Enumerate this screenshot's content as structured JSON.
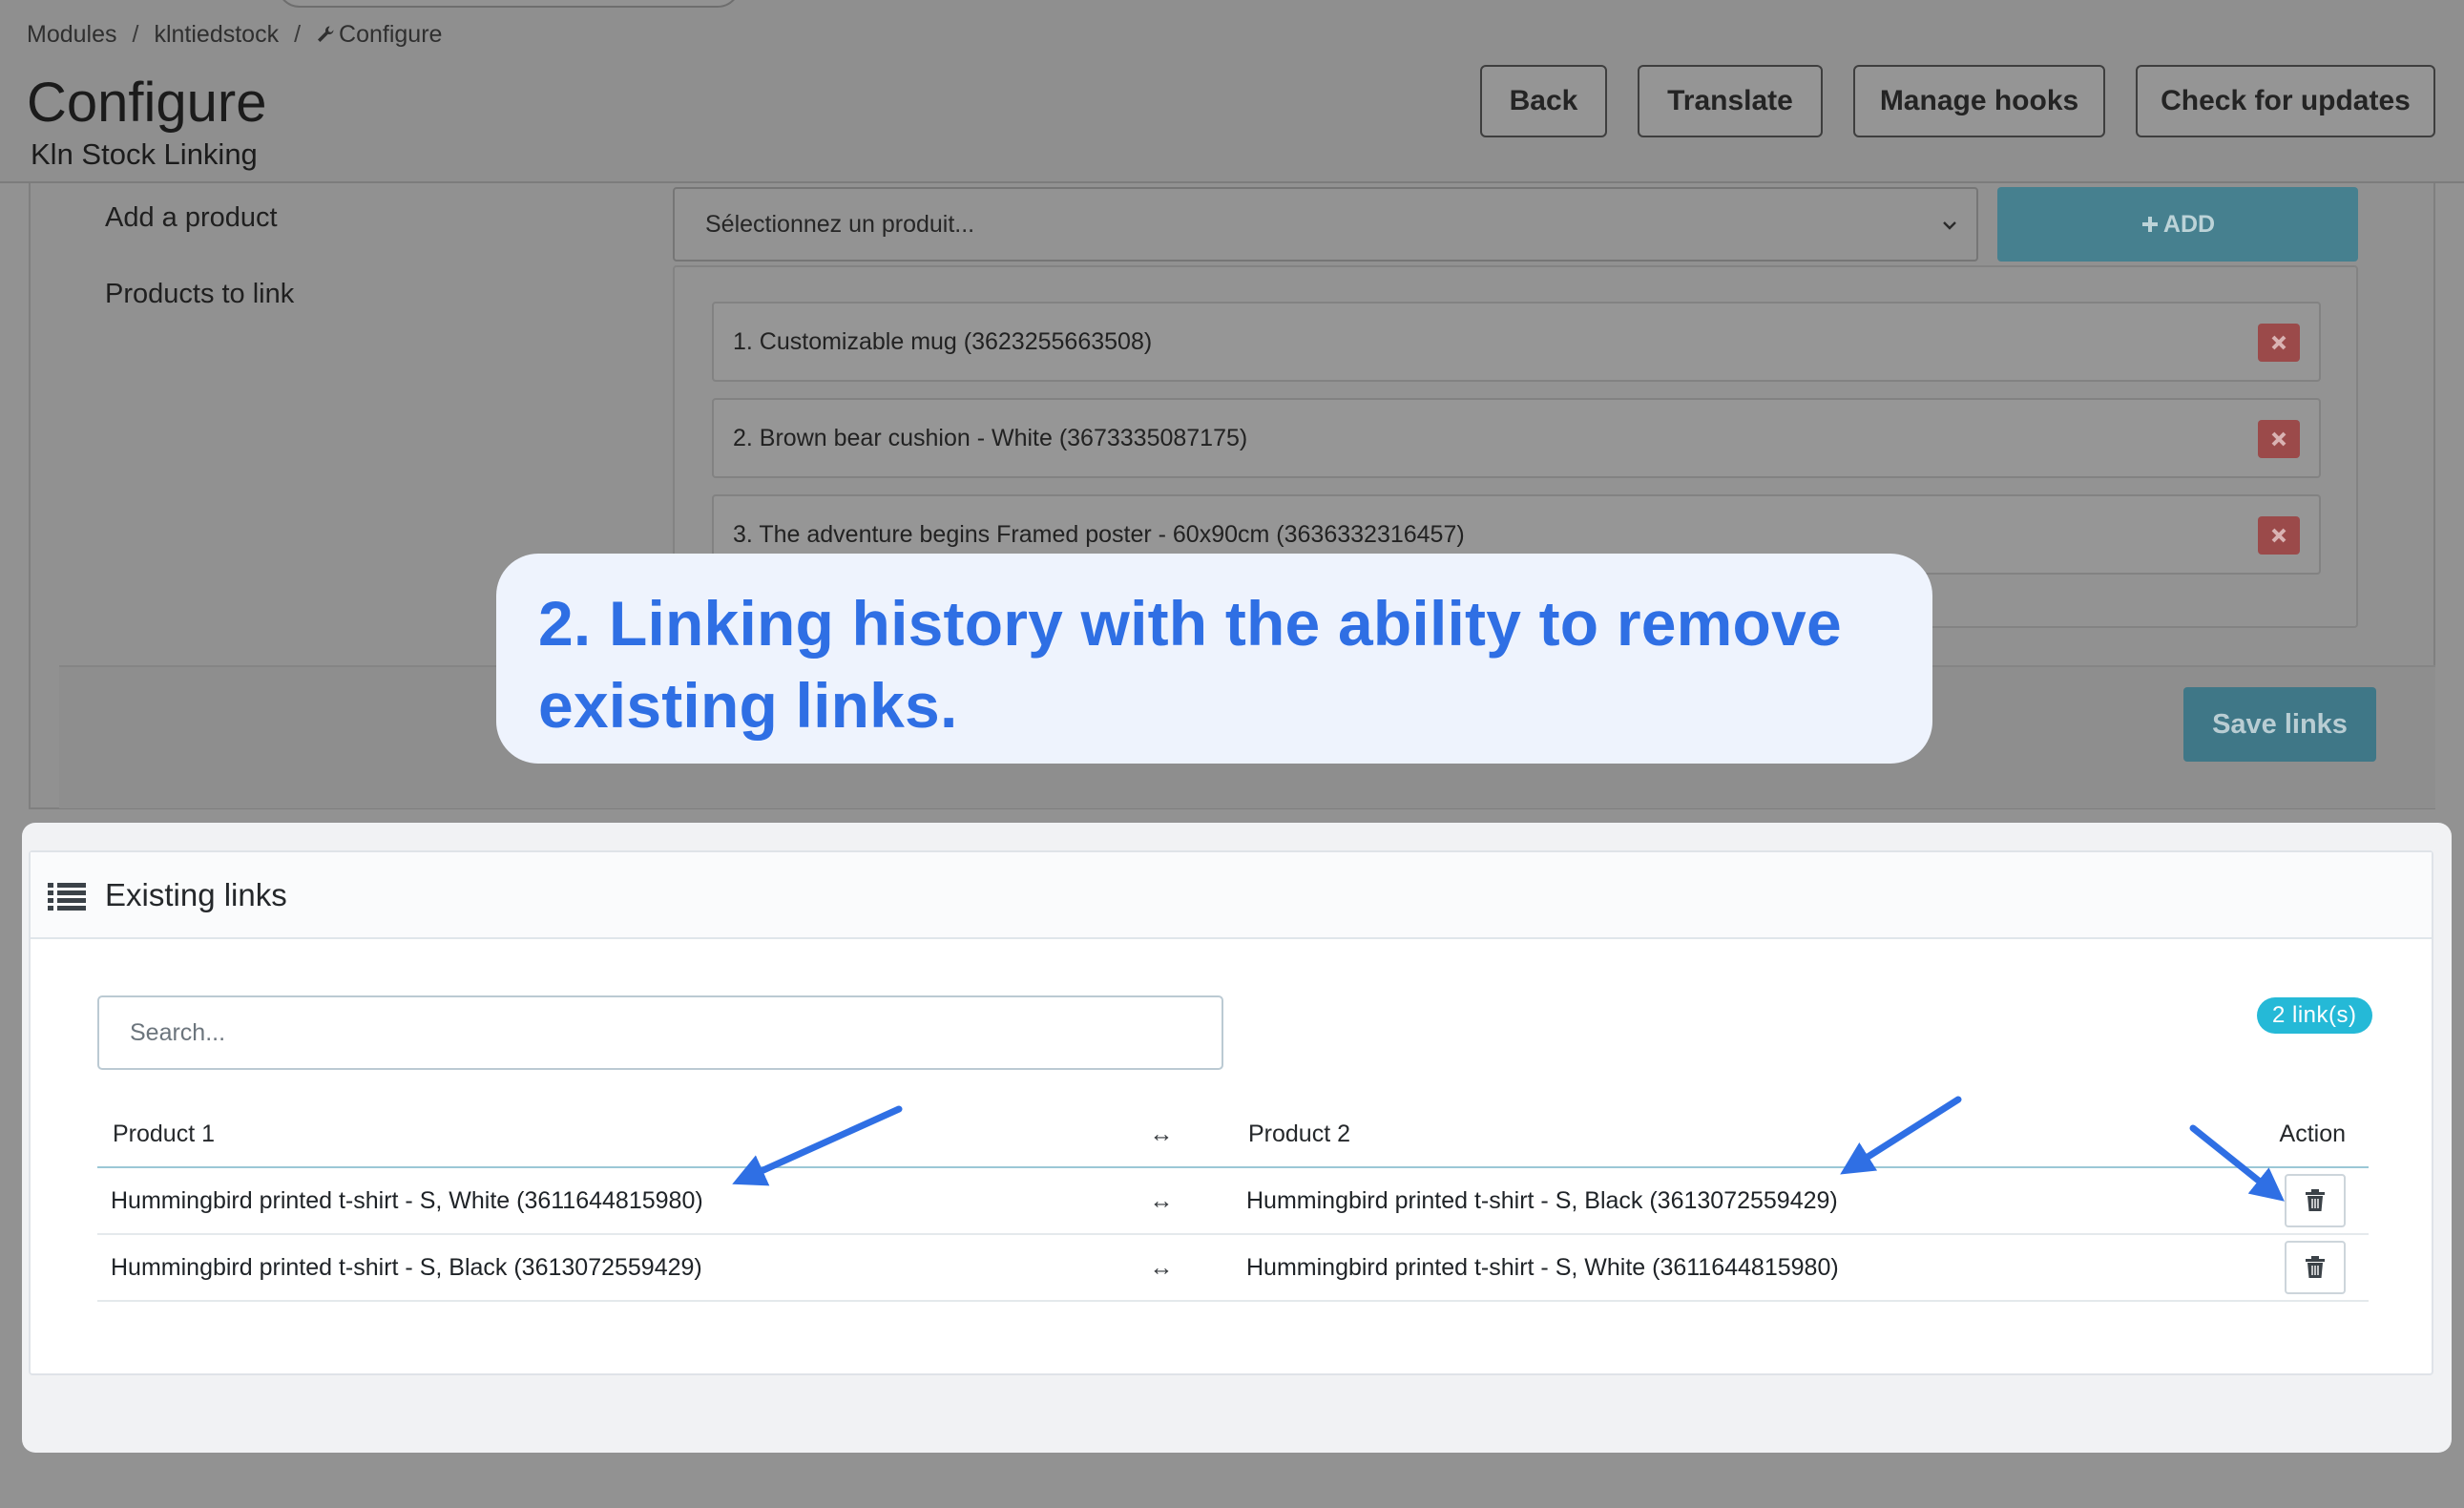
{
  "breadcrumb": {
    "items": [
      "Modules",
      "klntiedstock",
      "Configure"
    ],
    "separator": "/"
  },
  "header": {
    "title": "Configure",
    "subtitle": "Kln Stock Linking",
    "buttons": {
      "back": "Back",
      "translate": "Translate",
      "manage_hooks": "Manage hooks",
      "check_updates": "Check for updates"
    }
  },
  "form": {
    "add_product_label": "Add a product",
    "products_to_link_label": "Products to link",
    "select_placeholder": "Sélectionnez un produit...",
    "add_button": "ADD",
    "products": [
      "1. Customizable mug (3623255663508)",
      "2. Brown bear cushion - White (3673335087175)",
      "3. The adventure begins Framed poster - 60x90cm (3636332316457)"
    ],
    "save_button": "Save links"
  },
  "callout": {
    "line1": "2. Linking history with the ability to remove",
    "line2": "existing links."
  },
  "existing_links": {
    "title": "Existing links",
    "search_placeholder": "Search...",
    "count_badge": "2 link(s)",
    "columns": {
      "product1": "Product 1",
      "arrow": "↔",
      "product2": "Product 2",
      "action": "Action"
    },
    "rows": [
      {
        "product1": "Hummingbird printed t-shirt - S, White (3611644815980)",
        "arrow": "↔",
        "product2": "Hummingbird printed t-shirt - S, Black (3613072559429)"
      },
      {
        "product1": "Hummingbird printed t-shirt - S, Black (3613072559429)",
        "arrow": "↔",
        "product2": "Hummingbird printed t-shirt - S, White (3611644815980)"
      }
    ]
  },
  "colors": {
    "accent_callout": "#2f6fe4",
    "badge": "#25b9d7",
    "annotation_arrow": "#2f6fe4",
    "remove_button": "#9b4a4a"
  },
  "icons": {
    "breadcrumb_configure": "wrench-icon",
    "card_title": "list-icon",
    "select": "chevron-down-icon",
    "add": "plus-icon",
    "remove": "close-icon",
    "row_action": "trash-icon"
  }
}
